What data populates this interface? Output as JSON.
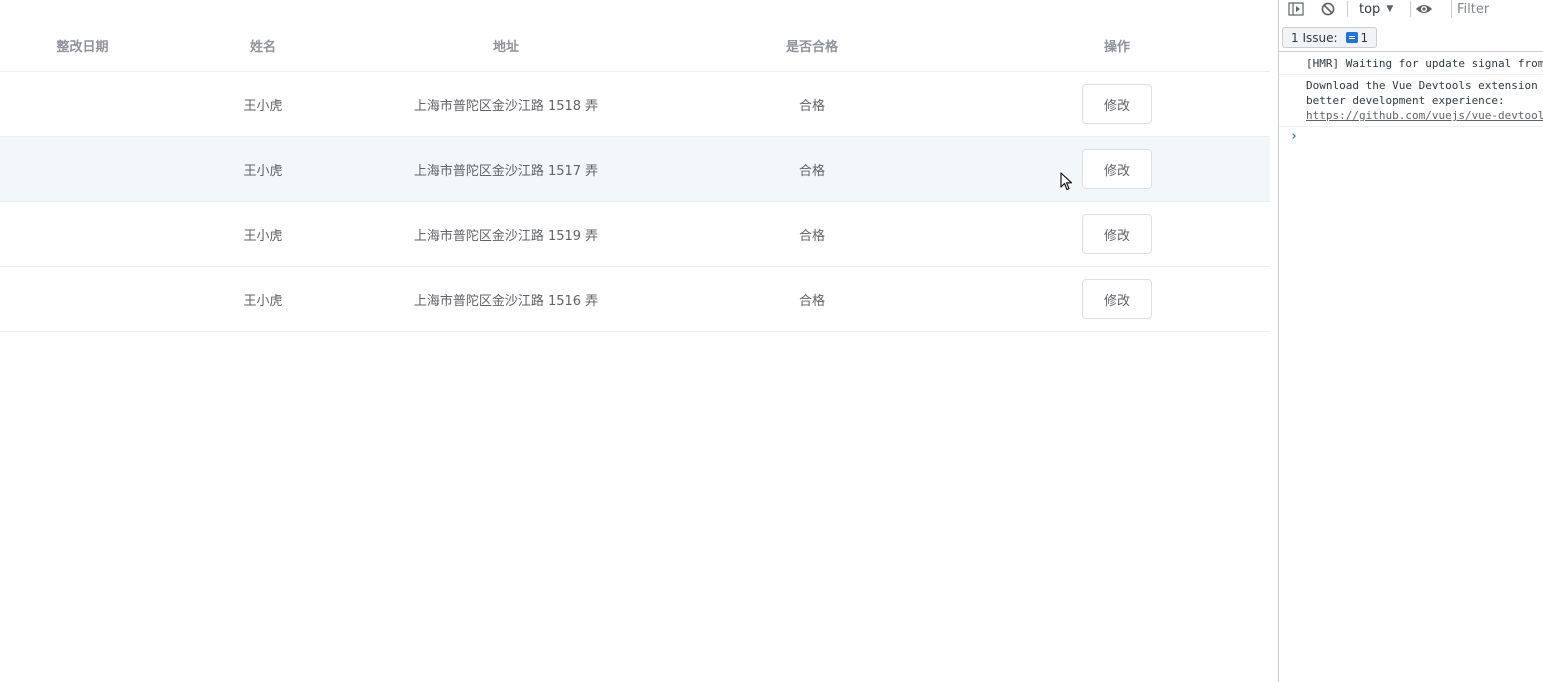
{
  "table": {
    "headers": {
      "date": "整改日期",
      "name": "姓名",
      "address": "地址",
      "pass": "是否合格",
      "op": "操作"
    },
    "rows": [
      {
        "date": "",
        "name": "王小虎",
        "address": "上海市普陀区金沙江路 1518 弄",
        "pass": "合格",
        "action": "修改"
      },
      {
        "date": "",
        "name": "王小虎",
        "address": "上海市普陀区金沙江路 1517 弄",
        "pass": "合格",
        "action": "修改"
      },
      {
        "date": "",
        "name": "王小虎",
        "address": "上海市普陀区金沙江路 1519 弄",
        "pass": "合格",
        "action": "修改"
      },
      {
        "date": "",
        "name": "王小虎",
        "address": "上海市普陀区金沙江路 1516 弄",
        "pass": "合格",
        "action": "修改"
      }
    ]
  },
  "devtools": {
    "context": "top",
    "filter_placeholder": "Filter",
    "issues_label": "1 Issue:",
    "issues_count": "1",
    "messages": [
      "[HMR] Waiting for update signal from WDS...",
      "Download the Vue Devtools extension for a\nbetter development experience:"
    ],
    "link": "https://github.com/vuejs/vue-devtools"
  },
  "colors": {
    "header_text": "#909399",
    "cell_text": "#606266",
    "row_border": "#ebeef5",
    "row_hover": "#f4f7f9",
    "accent": "#1a73e8"
  },
  "icons": [
    "sidebar-toggle-icon",
    "clear-console-icon",
    "eye-icon",
    "issue-icon",
    "cursor-icon"
  ]
}
